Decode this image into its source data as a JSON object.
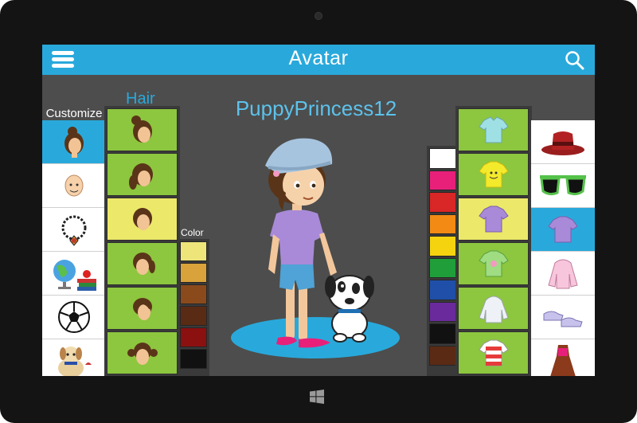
{
  "app": {
    "title": "Avatar",
    "username": "PuppyPrincess12"
  },
  "icons": {
    "menu": "hamburger-menu-icon",
    "search": "search-icon",
    "windows": "windows-logo-icon"
  },
  "labels": {
    "customize": "Customize",
    "hair": "Hair",
    "color": "Color"
  },
  "colors": {
    "accent": "#29a9db",
    "option_bg": "#8dc63f",
    "option_selected": "#ece86a",
    "screen_bg": "#4d4d4d"
  },
  "customize_categories": [
    {
      "name": "hair",
      "icon": "hair-head-icon",
      "active": true
    },
    {
      "name": "face",
      "icon": "face-icon",
      "active": false
    },
    {
      "name": "necklace",
      "icon": "necklace-icon",
      "active": false
    },
    {
      "name": "school",
      "icon": "globe-books-icon",
      "active": false
    },
    {
      "name": "sports",
      "icon": "soccer-ball-icon",
      "active": false
    },
    {
      "name": "pets",
      "icon": "puppy-icon",
      "active": false
    }
  ],
  "hair_styles": [
    {
      "name": "bun",
      "selected": false
    },
    {
      "name": "ponytail",
      "selected": false
    },
    {
      "name": "short-bob",
      "selected": true
    },
    {
      "name": "side-tail",
      "selected": false
    },
    {
      "name": "swoop",
      "selected": false
    },
    {
      "name": "pigtails",
      "selected": false
    }
  ],
  "hair_colors": [
    "#eee57a",
    "#d9a23a",
    "#8a4a1c",
    "#5a2b14",
    "#8b1010",
    "#111111"
  ],
  "outfit_colors": [
    "#ffffff",
    "#e8207a",
    "#d92626",
    "#f28a14",
    "#f5d30f",
    "#1f9e3a",
    "#1f4fa8",
    "#6a2a9c",
    "#111111",
    "#5a2a14"
  ],
  "tops": [
    {
      "name": "polo",
      "color": "#9fe0e4",
      "selected": false
    },
    {
      "name": "smiley-tee",
      "color": "#f4ea2c",
      "selected": false
    },
    {
      "name": "purple-tee",
      "color": "#a98ad8",
      "selected": true
    },
    {
      "name": "green-tee",
      "color": "#9fdc82",
      "selected": false
    },
    {
      "name": "hoodie",
      "color": "#eef2f6",
      "selected": false
    },
    {
      "name": "striped-tee",
      "color": "#e63b3b",
      "selected": false
    }
  ],
  "accessory_categories": [
    {
      "name": "hat",
      "icon": "hat-icon",
      "active": false
    },
    {
      "name": "glasses",
      "icon": "sunglasses-icon",
      "active": false
    },
    {
      "name": "tops",
      "icon": "shirt-icon",
      "active": true
    },
    {
      "name": "jacket",
      "icon": "jacket-icon",
      "active": false
    },
    {
      "name": "shoes",
      "icon": "sneakers-icon",
      "active": false
    },
    {
      "name": "dress",
      "icon": "dress-icon",
      "active": false
    }
  ]
}
